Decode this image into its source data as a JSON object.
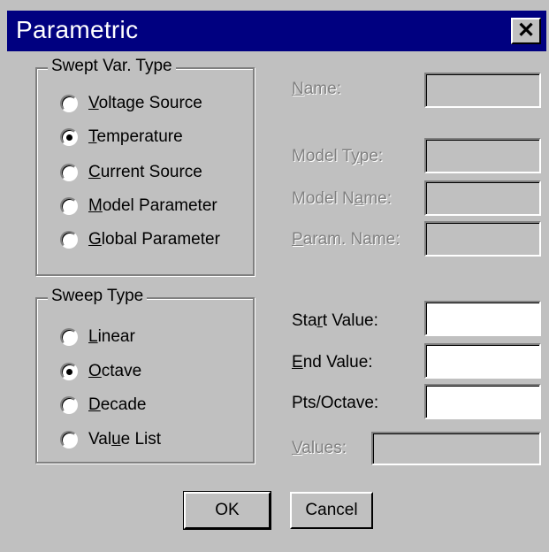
{
  "window": {
    "title": "Parametric",
    "close_glyph": "✕"
  },
  "swept_var_type": {
    "legend": "Swept Var. Type",
    "options": [
      {
        "pre": "",
        "key": "V",
        "post": "oltage Source",
        "selected": false
      },
      {
        "pre": "",
        "key": "T",
        "post": "emperature",
        "selected": true
      },
      {
        "pre": "",
        "key": "C",
        "post": "urrent Source",
        "selected": false
      },
      {
        "pre": "",
        "key": "M",
        "post": "odel Parameter",
        "selected": false
      },
      {
        "pre": "",
        "key": "G",
        "post": "lobal Parameter",
        "selected": false
      }
    ]
  },
  "sweep_type": {
    "legend": "Sweep Type",
    "options": [
      {
        "pre": "",
        "key": "L",
        "post": "inear",
        "selected": false
      },
      {
        "pre": "",
        "key": "O",
        "post": "ctave",
        "selected": true
      },
      {
        "pre": "",
        "key": "D",
        "post": "ecade",
        "selected": false
      },
      {
        "pre": "Val",
        "key": "u",
        "post": "e List",
        "selected": false
      }
    ]
  },
  "fields": {
    "name": {
      "pre": "",
      "key": "N",
      "post": "ame:",
      "value": "",
      "enabled": false
    },
    "model_type": {
      "pre": "Model T",
      "key": "y",
      "post": "pe:",
      "value": "",
      "enabled": false
    },
    "model_name": {
      "pre": "Model N",
      "key": "a",
      "post": "me:",
      "value": "",
      "enabled": false
    },
    "param_name": {
      "pre": "",
      "key": "P",
      "post": "aram. Name:",
      "value": "",
      "enabled": false
    },
    "start_value": {
      "pre": "Sta",
      "key": "r",
      "post": "t Value:",
      "value": "",
      "enabled": true
    },
    "end_value": {
      "pre": "",
      "key": "E",
      "post": "nd Value:",
      "value": "",
      "enabled": true
    },
    "pts_octave": {
      "pre": "Pts/Octave:",
      "key": "",
      "post": "",
      "value": "",
      "enabled": true
    },
    "values": {
      "pre": "",
      "key": "V",
      "post": "alues:",
      "value": "",
      "enabled": false
    }
  },
  "buttons": {
    "ok": "OK",
    "cancel": "Cancel"
  },
  "colors": {
    "titlebar": "#000080",
    "face": "#c0c0c0",
    "disabled_text": "#808080"
  }
}
